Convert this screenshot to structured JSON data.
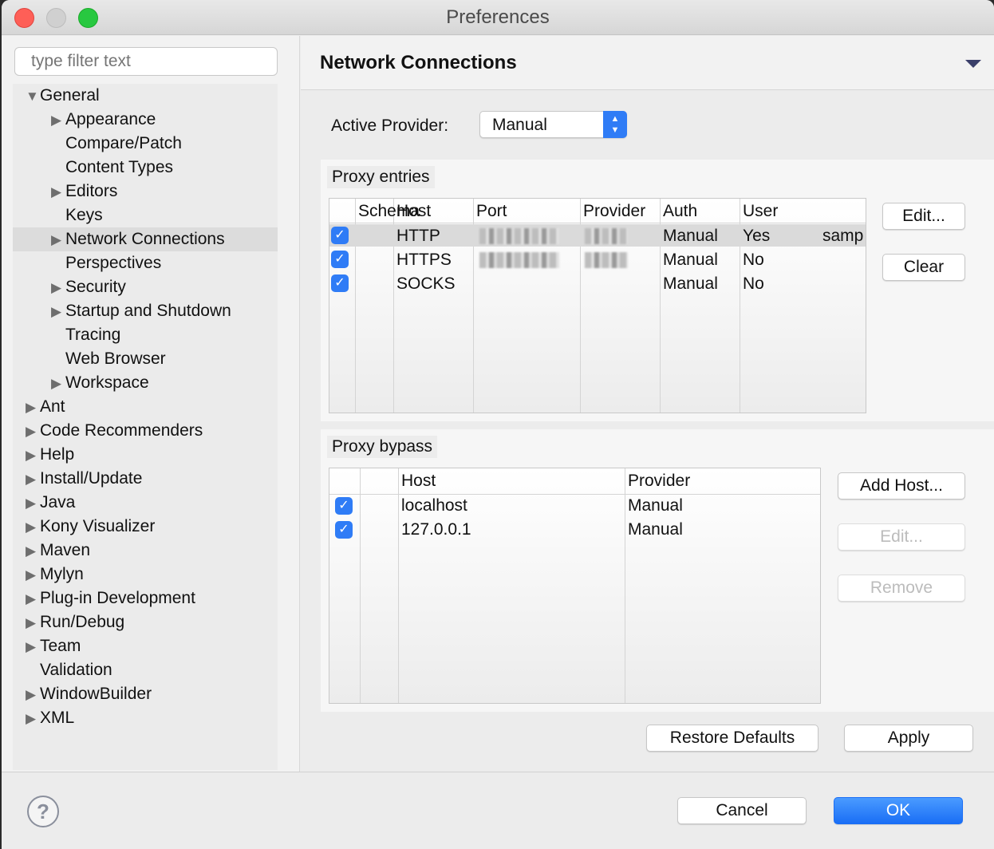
{
  "window": {
    "title": "Preferences"
  },
  "sidebar": {
    "filter_placeholder": "type filter text",
    "items": [
      {
        "label": "General",
        "level": 0,
        "twisty": "expanded"
      },
      {
        "label": "Appearance",
        "level": 1,
        "twisty": "collapsed"
      },
      {
        "label": "Compare/Patch",
        "level": 1,
        "twisty": "none"
      },
      {
        "label": "Content Types",
        "level": 1,
        "twisty": "none"
      },
      {
        "label": "Editors",
        "level": 1,
        "twisty": "collapsed"
      },
      {
        "label": "Keys",
        "level": 1,
        "twisty": "none"
      },
      {
        "label": "Network Connections",
        "level": 1,
        "twisty": "collapsed",
        "selected": true
      },
      {
        "label": "Perspectives",
        "level": 1,
        "twisty": "none"
      },
      {
        "label": "Security",
        "level": 1,
        "twisty": "collapsed"
      },
      {
        "label": "Startup and Shutdown",
        "level": 1,
        "twisty": "collapsed"
      },
      {
        "label": "Tracing",
        "level": 1,
        "twisty": "none"
      },
      {
        "label": "Web Browser",
        "level": 1,
        "twisty": "none"
      },
      {
        "label": "Workspace",
        "level": 1,
        "twisty": "collapsed"
      },
      {
        "label": "Ant",
        "level": 0,
        "twisty": "collapsed"
      },
      {
        "label": "Code Recommenders",
        "level": 0,
        "twisty": "collapsed"
      },
      {
        "label": "Help",
        "level": 0,
        "twisty": "collapsed"
      },
      {
        "label": "Install/Update",
        "level": 0,
        "twisty": "collapsed"
      },
      {
        "label": "Java",
        "level": 0,
        "twisty": "collapsed"
      },
      {
        "label": "Kony Visualizer",
        "level": 0,
        "twisty": "collapsed"
      },
      {
        "label": "Maven",
        "level": 0,
        "twisty": "collapsed"
      },
      {
        "label": "Mylyn",
        "level": 0,
        "twisty": "collapsed"
      },
      {
        "label": "Plug-in Development",
        "level": 0,
        "twisty": "collapsed"
      },
      {
        "label": "Run/Debug",
        "level": 0,
        "twisty": "collapsed"
      },
      {
        "label": "Team",
        "level": 0,
        "twisty": "collapsed"
      },
      {
        "label": "Validation",
        "level": 0,
        "twisty": "none"
      },
      {
        "label": "WindowBuilder",
        "level": 0,
        "twisty": "collapsed"
      },
      {
        "label": "XML",
        "level": 0,
        "twisty": "collapsed"
      }
    ]
  },
  "page": {
    "title": "Network Connections",
    "active_provider_label": "Active Provider:",
    "active_provider_value": "Manual"
  },
  "proxy_entries": {
    "label": "Proxy entries",
    "columns": [
      "Schema",
      "Host",
      "Port",
      "Provider",
      "Auth",
      "User"
    ],
    "rows": [
      {
        "checked": true,
        "schema": "HTTP",
        "provider": "Manual",
        "auth": "Yes",
        "user": "samp"
      },
      {
        "checked": true,
        "schema": "HTTPS",
        "provider": "Manual",
        "auth": "No",
        "user": ""
      },
      {
        "checked": true,
        "schema": "SOCKS",
        "provider": "Manual",
        "auth": "No",
        "user": ""
      }
    ],
    "edit_label": "Edit...",
    "clear_label": "Clear"
  },
  "proxy_bypass": {
    "label": "Proxy bypass",
    "columns": [
      "Host",
      "Provider"
    ],
    "rows": [
      {
        "checked": true,
        "host": "localhost",
        "provider": "Manual"
      },
      {
        "checked": true,
        "host": "127.0.0.1",
        "provider": "Manual"
      }
    ],
    "add_host_label": "Add Host...",
    "edit_label": "Edit...",
    "remove_label": "Remove"
  },
  "buttons": {
    "restore_defaults": "Restore Defaults",
    "apply": "Apply",
    "cancel": "Cancel",
    "ok": "OK"
  },
  "colors": {
    "accent": "#2f7cf6",
    "ok": "#1a7cf5"
  }
}
